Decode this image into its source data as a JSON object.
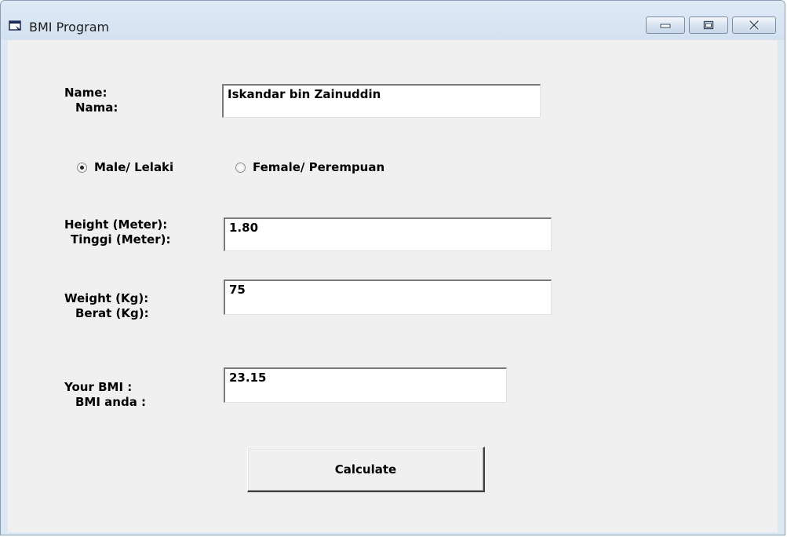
{
  "window": {
    "title": "BMI Program"
  },
  "form": {
    "name_label_en": "Name:",
    "name_label_ms": "Nama:",
    "name_value": "Iskandar bin Zainuddin",
    "gender": {
      "male_label": "Male/ Lelaki",
      "female_label": "Female/ Perempuan",
      "selected": "male"
    },
    "height_label_en": "Height (Meter):",
    "height_label_ms": "Tinggi (Meter):",
    "height_value": "1.80",
    "weight_label_en": "Weight (Kg):",
    "weight_label_ms": "Berat (Kg):",
    "weight_value": "75",
    "bmi_label_en": "Your BMI :",
    "bmi_label_ms": "BMI anda :",
    "bmi_value": "23.15",
    "calculate_label": "Calculate"
  },
  "icons": {
    "app": "window-app-icon",
    "minimize": "minimize-icon",
    "maximize": "maximize-icon",
    "close": "close-icon"
  }
}
